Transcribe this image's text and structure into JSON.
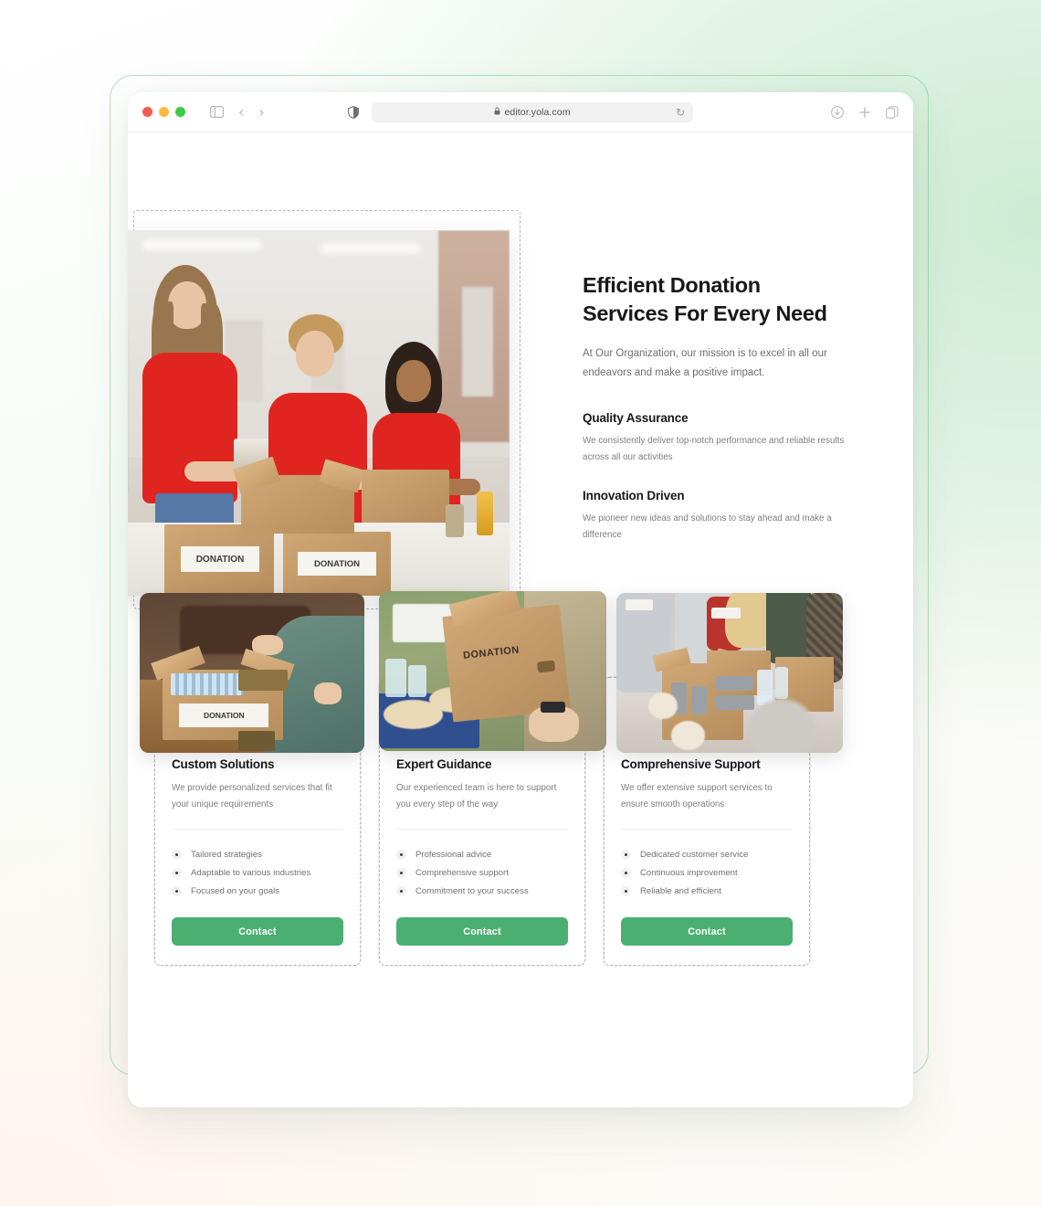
{
  "browser": {
    "traffic_lights": [
      "close",
      "minimize",
      "maximize"
    ],
    "sidebar_icon": "sidebar-toggle-icon",
    "back_label": "‹",
    "forward_label": "›",
    "shield_icon": "privacy-shield-icon",
    "lock_glyph": "🔒",
    "url": "editor.yola.com",
    "reload_glyph": "↻",
    "download_icon": "download-icon",
    "new_tab_label": "+",
    "tabs_icon": "tab-overview-icon"
  },
  "hero": {
    "title_line1": "Efficient Donation",
    "title_line2": "Services For Every Need",
    "subtitle": "At Our Organization, our mission is to excel in all our endeavors and make a positive impact.",
    "image_alt": "volunteers-in-red-shirts-packing-donation-boxes",
    "features": [
      {
        "title": "Quality Assurance",
        "body": "We consistently deliver top-notch performance and reliable results across all our activities"
      },
      {
        "title": "Innovation Driven",
        "body": "We pioneer new ideas and solutions to stay ahead and make a difference"
      }
    ]
  },
  "cards": [
    {
      "image_alt": "hand-placing-can-into-donation-box",
      "title": "Custom Solutions",
      "desc": "We provide personalized services that fit your unique requirements",
      "items": [
        "Tailored strategies",
        "Adaptable to various industries",
        "Focused on your goals"
      ],
      "button": "Contact"
    },
    {
      "image_alt": "person-carrying-donation-cardboard-box",
      "title": "Expert Guidance",
      "desc": "Our experienced team is here to support you every step of the way",
      "items": [
        "Professional advice",
        "Comprehensive support",
        "Commitment to your success"
      ],
      "button": "Contact"
    },
    {
      "image_alt": "volunteers-sorting-food-donations-on-table",
      "title": "Comprehensive Support",
      "desc": "We offer extensive support services to ensure smooth operations",
      "items": [
        "Dedicated customer service",
        "Continuous improvement",
        "Reliable and efficient"
      ],
      "button": "Contact"
    }
  ],
  "photo_text": {
    "donation_label": "DONATION"
  },
  "colors": {
    "accent_green": "#4caf72",
    "shirt_red": "#e0241f",
    "heading": "#17181a",
    "body_text": "#7a7e81",
    "frame_outline": "#7ac891",
    "selection_dashed": "#b8b8b8"
  }
}
